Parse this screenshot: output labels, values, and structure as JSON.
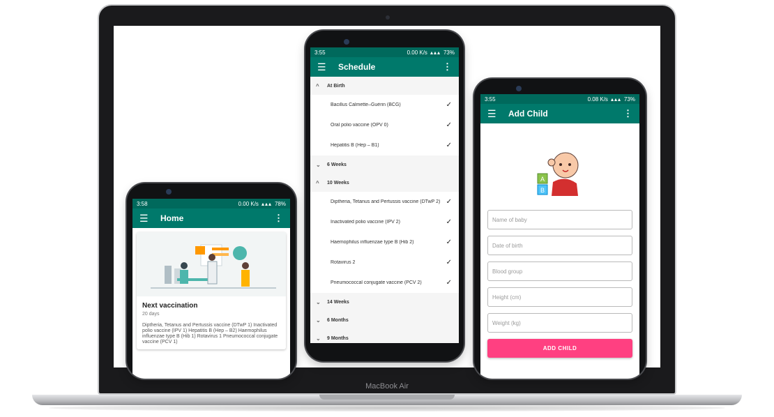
{
  "laptop": {
    "brand": "MacBook Air"
  },
  "home_screen": {
    "status": {
      "time": "3:58",
      "speed": "0.00 K/s",
      "battery": "78%"
    },
    "title": "Home",
    "icons": {
      "menu": "menu-icon",
      "more": "more-vert-icon"
    },
    "card": {
      "title": "Next vaccination",
      "days": "20 days",
      "vaccines": "Diptheria, Tetanus and Pertussis vaccine (DTwP 1) Inactivated polio vaccine (IPV 1) Hepatitis B  (Hep – B2) Haemophilus influenzae type B (Hib 1) Rotavirus 1 Pneumococcal conjugate vaccine (PCV 1)"
    }
  },
  "schedule_screen": {
    "status": {
      "time": "3:55",
      "speed": "0.00 K/s",
      "battery": "73%"
    },
    "title": "Schedule",
    "sections": [
      {
        "label": "At Birth",
        "expanded": true,
        "items": [
          {
            "name": "Bacillus Calmette–Guérin (BCG)",
            "done": "✓"
          },
          {
            "name": "Oral polio vaccine (OPV 0)",
            "done": "✓"
          },
          {
            "name": "Hepatitis B (Hep – B1)",
            "done": "✓"
          }
        ]
      },
      {
        "label": "6 Weeks",
        "expanded": false,
        "items": []
      },
      {
        "label": "10 Weeks",
        "expanded": true,
        "items": [
          {
            "name": "Diptheria, Tetanus and Pertussis vaccine (DTwP 2)",
            "done": "✓"
          },
          {
            "name": "Inactivated polio vaccine (IPV 2)",
            "done": "✓"
          },
          {
            "name": "Haemophilus influenzae type B (Hib 2)",
            "done": "✓"
          },
          {
            "name": "Rotavirus 2",
            "done": "✓"
          },
          {
            "name": "Pneumococcal conjugate vaccine (PCV 2)",
            "done": "✓"
          }
        ]
      },
      {
        "label": "14 Weeks",
        "expanded": false,
        "items": []
      },
      {
        "label": "6 Months",
        "expanded": false,
        "items": []
      },
      {
        "label": "9 Months",
        "expanded": false,
        "items": []
      }
    ]
  },
  "add_child_screen": {
    "status": {
      "time": "3:55",
      "speed": "0.08 K/s",
      "battery": "73%"
    },
    "title": "Add Child",
    "image": "baby-with-blocks-icon",
    "block_letters": [
      "A",
      "B"
    ],
    "fields": {
      "name": "Name of baby",
      "dob": "Date of birth",
      "blood": "Blood group",
      "height": "Height (cm)",
      "weight": "Weight (kg)"
    },
    "submit": "ADD CHILD"
  },
  "colors": {
    "primary": "#00796b",
    "primary_dark": "#00695c",
    "accent": "#ff4081"
  }
}
